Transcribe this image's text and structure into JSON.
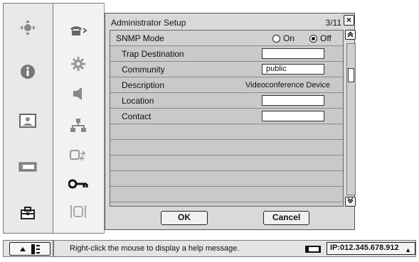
{
  "sidebar_left": {
    "icons": [
      "camera-control-icon",
      "info-icon",
      "picture-icon",
      "video-source-icon",
      "toolbox-icon"
    ]
  },
  "sidebar_mid": {
    "icons": [
      "phone-icon",
      "gear-icon",
      "speaker-icon",
      "network-icon",
      "display-switch-icon",
      "key-icon",
      "frame-icon"
    ]
  },
  "dialog": {
    "title": "Administrator Setup",
    "page": "3/11",
    "close_label": "×",
    "rows": [
      {
        "label": "SNMP Mode",
        "type": "radio",
        "options": [
          "On",
          "Off"
        ],
        "selected": "Off"
      },
      {
        "label": "Trap Destination",
        "type": "input",
        "value": ""
      },
      {
        "label": "Community",
        "type": "input",
        "value": "public"
      },
      {
        "label": "Description",
        "type": "text",
        "value": "Videoconference Device"
      },
      {
        "label": "Location",
        "type": "input",
        "value": ""
      },
      {
        "label": "Contact",
        "type": "input",
        "value": ""
      }
    ],
    "ok_label": "OK",
    "cancel_label": "Cancel"
  },
  "status": {
    "message": "Right-click the mouse to display a help message.",
    "ip": "IP:012.345.678.912"
  },
  "colors": {
    "dialog_bg": "#d9d9d9",
    "list_bg": "#c9c9c9",
    "sidebar_bg": "#e9e9e9"
  }
}
